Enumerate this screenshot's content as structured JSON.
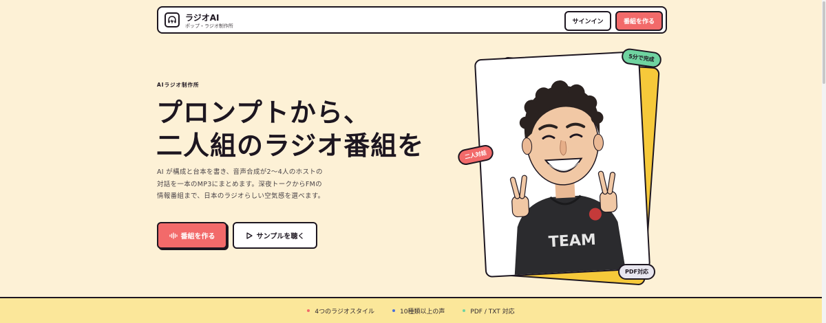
{
  "header": {
    "brand_name": "ラジオAI",
    "brand_sub": "ポップ・ラジオ制作所",
    "signin_label": "サインイン",
    "create_label": "番組を作る"
  },
  "hero": {
    "eyebrow": "AIラジオ制作所",
    "title_line1": "プロンプトから、",
    "title_line2": "二人組のラジオ番組を",
    "description": "AI が構成と台本を書き、音声合成が2〜4人のホストの対話を一本のMP3にまとめます。深夜トークからFMの情報番組まで、日本のラジオらしい空気感を選べます。",
    "primary_button": "番組を作る",
    "secondary_button": "サンプルを聴く"
  },
  "card": {
    "tag_time": "5分で完成",
    "tag_duo": "二人対話",
    "tag_pdf": "PDF対応",
    "shirt_text": "TEAM"
  },
  "features": [
    {
      "label": "4つのラジオスタイル",
      "color": "#f26a6a"
    },
    {
      "label": "10種類以上の声",
      "color": "#4a6fd8"
    },
    {
      "label": "PDF / TXT 対応",
      "color": "#6fd3a0"
    }
  ],
  "colors": {
    "accent": "#f26a6a",
    "background": "#fdf1d6",
    "strip": "#fbe79a",
    "card_back": "#f6c93a"
  }
}
